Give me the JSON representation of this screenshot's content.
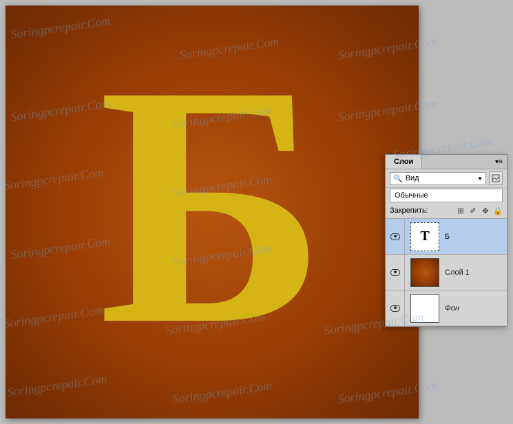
{
  "watermark": "Soringpcrepair.Com",
  "canvas": {
    "letter": "Б"
  },
  "layers_panel": {
    "tab_label": "Слои",
    "filter_label": "Вид",
    "type_label": "Обычные",
    "lock_label": "Закрепить:",
    "lock_icons": {
      "pixels": "⊞",
      "brush": "✐",
      "move": "✥",
      "all": "🔒"
    },
    "layers": [
      {
        "name": "Б",
        "type": "text",
        "thumb_letter": "T",
        "selected": true,
        "italic": false
      },
      {
        "name": "Слой 1",
        "type": "raster",
        "selected": false,
        "italic": false
      },
      {
        "name": "Фон",
        "type": "background",
        "selected": false,
        "italic": true
      }
    ]
  }
}
